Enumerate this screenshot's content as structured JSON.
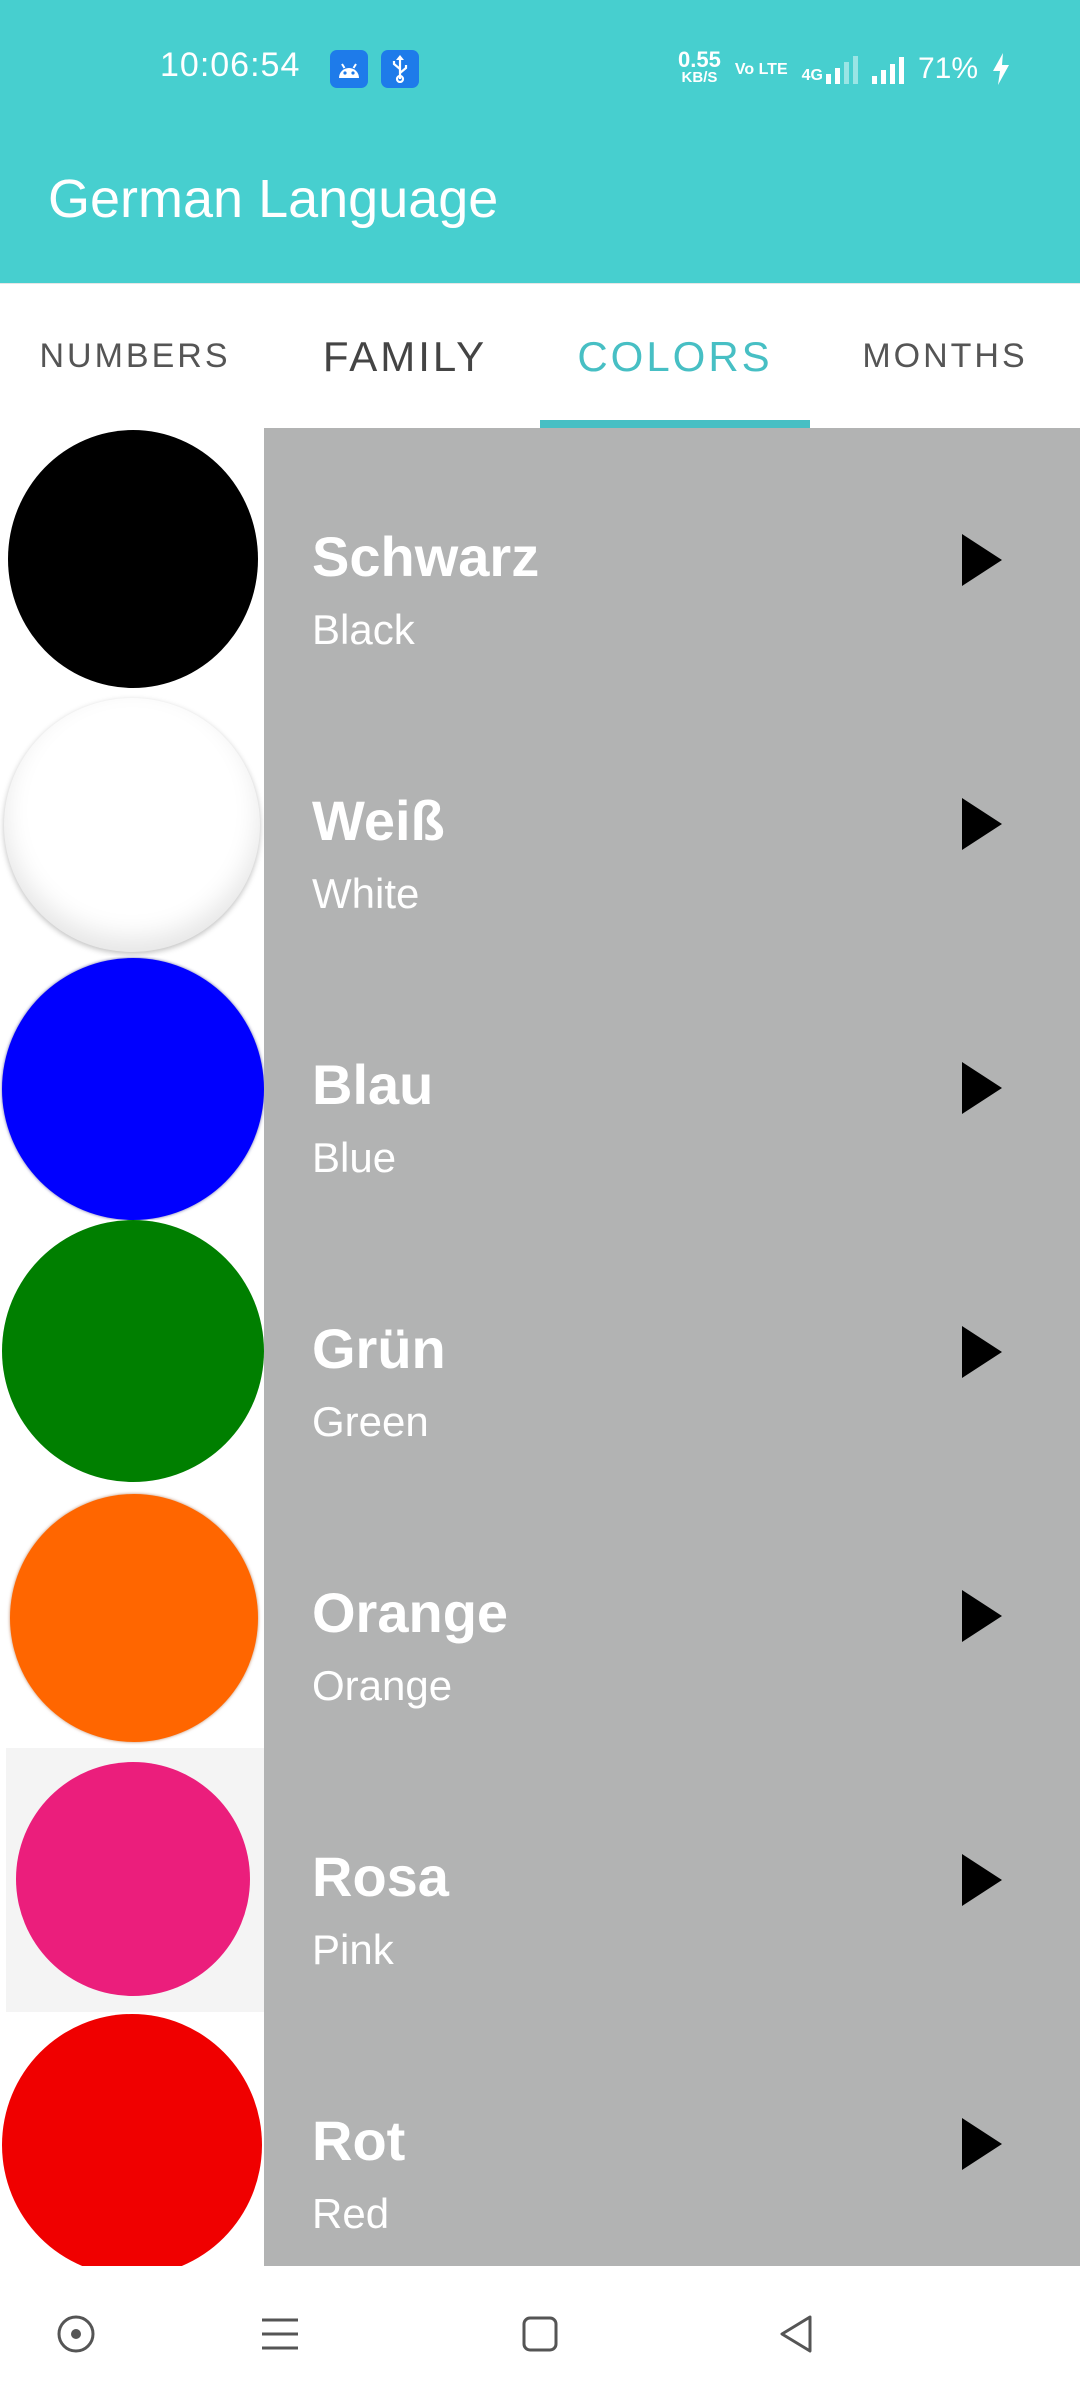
{
  "status_bar": {
    "time": "10:06:54",
    "net_speed_value": "0.55",
    "net_speed_unit": "KB/S",
    "volte": "Vo LTE",
    "network": "4G",
    "battery": "71%",
    "icons": [
      "android-icon",
      "usb-icon",
      "signal-icon",
      "charging-icon"
    ]
  },
  "app_bar": {
    "title": "German Language",
    "color": "#47CFCF"
  },
  "tabs": [
    {
      "label": "Numbers",
      "active": false
    },
    {
      "label": "Family",
      "active": false
    },
    {
      "label": "Colors",
      "active": true
    },
    {
      "label": "Months",
      "active": false
    }
  ],
  "accent_color": "#47BFC4",
  "list_background": "#B2B3B3",
  "colors": [
    {
      "german": "Schwarz",
      "english": "Black",
      "swatch": "#000000"
    },
    {
      "german": "Weiß",
      "english": "White",
      "swatch": "#ffffff"
    },
    {
      "german": "Blau",
      "english": "Blue",
      "swatch": "#0000FF"
    },
    {
      "german": "Grün",
      "english": "Green",
      "swatch": "#007F00"
    },
    {
      "german": "Orange",
      "english": "Orange",
      "swatch": "#FF6600"
    },
    {
      "german": "Rosa",
      "english": "Pink",
      "swatch": "#EB1E7C"
    },
    {
      "german": "Rot",
      "english": "Red",
      "swatch": "#F00000"
    }
  ],
  "nav_bar": {
    "icons": [
      "assistant-icon",
      "menu-icon",
      "home-icon",
      "back-icon"
    ]
  }
}
